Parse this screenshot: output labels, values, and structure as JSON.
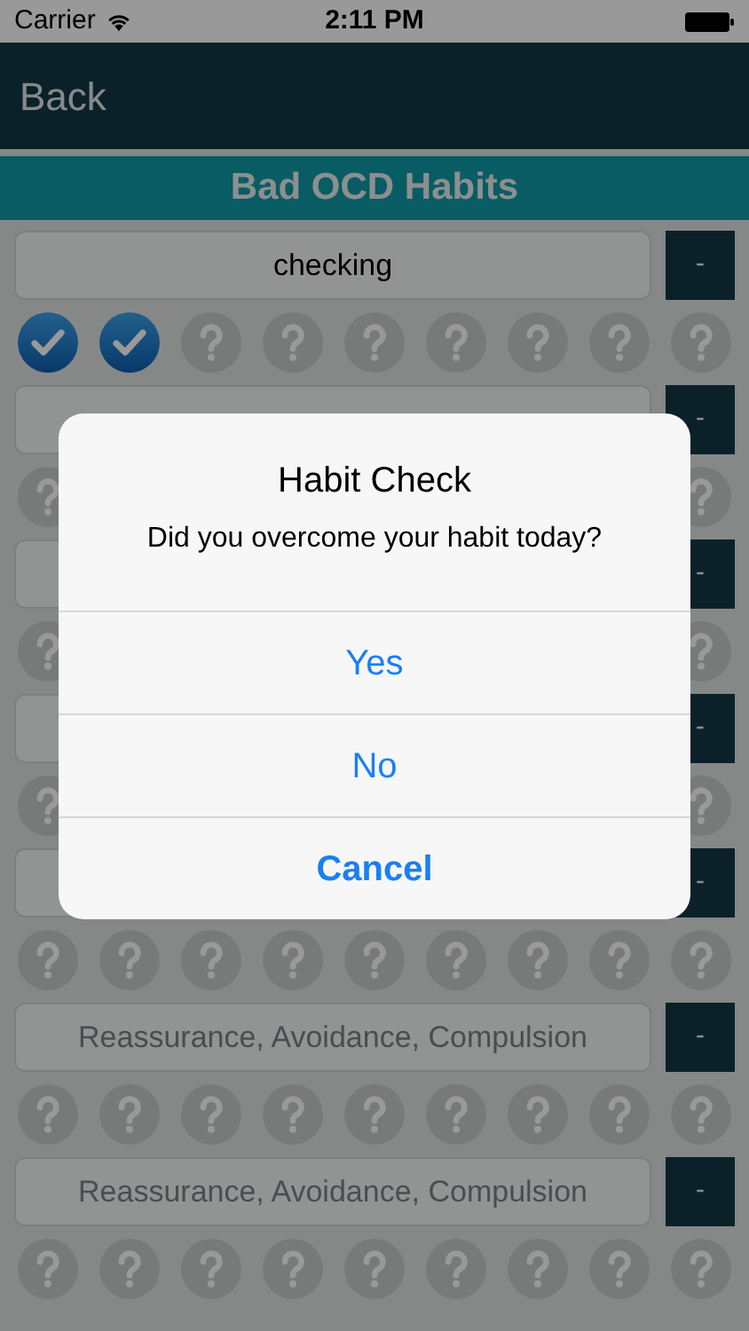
{
  "status_bar": {
    "carrier": "Carrier",
    "time": "2:11 PM"
  },
  "nav": {
    "back": "Back"
  },
  "header": {
    "title": "Bad OCD Habits"
  },
  "habits": [
    {
      "value": "checking",
      "button": "-",
      "days": [
        {
          "checked": true
        },
        {
          "checked": true
        },
        {
          "checked": false
        },
        {
          "checked": false
        },
        {
          "checked": false
        },
        {
          "checked": false
        },
        {
          "checked": false
        },
        {
          "checked": false
        },
        {
          "checked": false
        }
      ]
    },
    {
      "button": "-",
      "days": [
        {
          "checked": false
        },
        {
          "checked": false
        }
      ]
    },
    {
      "button": "-",
      "days": [
        {
          "checked": false
        },
        {
          "checked": false
        }
      ]
    },
    {
      "button": "-",
      "days": [
        {
          "checked": false
        },
        {
          "checked": false
        }
      ]
    },
    {
      "button": "-",
      "days": [
        {
          "checked": false
        },
        {
          "checked": false
        },
        {
          "checked": false
        },
        {
          "checked": false
        },
        {
          "checked": false
        },
        {
          "checked": false
        },
        {
          "checked": false
        },
        {
          "checked": false
        },
        {
          "checked": false
        }
      ]
    },
    {
      "placeholder": "Reassurance, Avoidance, Compulsion",
      "button": "-",
      "days": [
        {
          "checked": false
        },
        {
          "checked": false
        },
        {
          "checked": false
        },
        {
          "checked": false
        },
        {
          "checked": false
        },
        {
          "checked": false
        },
        {
          "checked": false
        },
        {
          "checked": false
        },
        {
          "checked": false
        }
      ]
    },
    {
      "placeholder": "Reassurance, Avoidance, Compulsion",
      "button": "-",
      "days": [
        {
          "checked": false
        },
        {
          "checked": false
        },
        {
          "checked": false
        },
        {
          "checked": false
        },
        {
          "checked": false
        },
        {
          "checked": false
        },
        {
          "checked": false
        },
        {
          "checked": false
        },
        {
          "checked": false
        }
      ]
    }
  ],
  "dialog": {
    "title": "Habit Check",
    "message": "Did you overcome your habit today?",
    "buttons": [
      {
        "label": "Yes",
        "kind": "default"
      },
      {
        "label": "No",
        "kind": "default"
      },
      {
        "label": "Cancel",
        "kind": "cancel"
      }
    ]
  }
}
